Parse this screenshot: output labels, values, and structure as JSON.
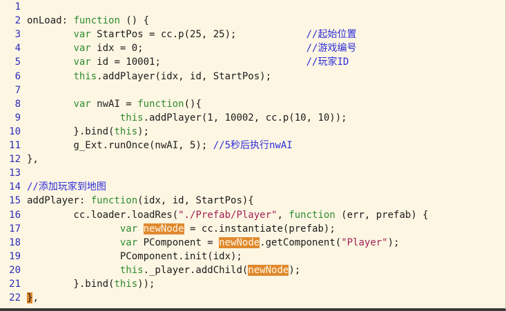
{
  "editor": {
    "lines": [
      {
        "n": "1",
        "segs": []
      },
      {
        "n": "2",
        "segs": [
          [
            "t",
            "onLoad: "
          ],
          [
            "k",
            "function"
          ],
          [
            "t",
            " () {"
          ]
        ]
      },
      {
        "n": "3",
        "segs": [
          [
            "t",
            "        "
          ],
          [
            "k",
            "var"
          ],
          [
            "t",
            " StartPos = cc.p(25, 25);            "
          ],
          [
            "c",
            "//起始位置"
          ]
        ]
      },
      {
        "n": "4",
        "segs": [
          [
            "t",
            "        "
          ],
          [
            "k",
            "var"
          ],
          [
            "t",
            " idx = 0;                            "
          ],
          [
            "c",
            "//游戏编号"
          ]
        ]
      },
      {
        "n": "5",
        "segs": [
          [
            "t",
            "        "
          ],
          [
            "k",
            "var"
          ],
          [
            "t",
            " id = 10001;                         "
          ],
          [
            "c",
            "//玩家ID"
          ]
        ]
      },
      {
        "n": "6",
        "segs": [
          [
            "t",
            "        "
          ],
          [
            "k",
            "this"
          ],
          [
            "t",
            ".addPlayer(idx, id, StartPos);"
          ]
        ]
      },
      {
        "n": "7",
        "segs": []
      },
      {
        "n": "8",
        "segs": [
          [
            "t",
            "        "
          ],
          [
            "k",
            "var"
          ],
          [
            "t",
            " nwAI = "
          ],
          [
            "k",
            "function"
          ],
          [
            "t",
            "(){"
          ]
        ]
      },
      {
        "n": "9",
        "segs": [
          [
            "t",
            "                "
          ],
          [
            "k",
            "this"
          ],
          [
            "t",
            ".addPlayer(1, 10002, cc.p(10, 10));"
          ]
        ]
      },
      {
        "n": "10",
        "segs": [
          [
            "t",
            "        }.bind("
          ],
          [
            "k",
            "this"
          ],
          [
            "t",
            ");"
          ]
        ]
      },
      {
        "n": "11",
        "segs": [
          [
            "t",
            "        g_Ext.runOnce(nwAI, 5); "
          ],
          [
            "c",
            "//5秒后执行nwAI"
          ]
        ]
      },
      {
        "n": "12",
        "segs": [
          [
            "t",
            "},"
          ]
        ]
      },
      {
        "n": "13",
        "segs": []
      },
      {
        "n": "14",
        "segs": [
          [
            "c",
            "//添加玩家到地图"
          ]
        ]
      },
      {
        "n": "15",
        "segs": [
          [
            "t",
            "addPlayer: "
          ],
          [
            "k",
            "function"
          ],
          [
            "t",
            "(idx, id, StartPos){"
          ]
        ]
      },
      {
        "n": "16",
        "segs": [
          [
            "t",
            "        cc.loader.loadRes("
          ],
          [
            "s",
            "\"./Prefab/Player\""
          ],
          [
            "t",
            ", "
          ],
          [
            "k",
            "function"
          ],
          [
            "t",
            " (err, prefab) {"
          ]
        ]
      },
      {
        "n": "17",
        "segs": [
          [
            "t",
            "                "
          ],
          [
            "k",
            "var"
          ],
          [
            "t",
            " "
          ],
          [
            "h",
            "newNode"
          ],
          [
            "t",
            " = cc.instantiate(prefab);"
          ]
        ]
      },
      {
        "n": "18",
        "segs": [
          [
            "t",
            "                "
          ],
          [
            "k",
            "var"
          ],
          [
            "t",
            " PComponent = "
          ],
          [
            "h",
            "newNode"
          ],
          [
            "t",
            ".getComponent("
          ],
          [
            "s",
            "\"Player\""
          ],
          [
            "t",
            ");"
          ]
        ]
      },
      {
        "n": "19",
        "segs": [
          [
            "t",
            "                PComponent.init(idx);"
          ]
        ]
      },
      {
        "n": "20",
        "segs": [
          [
            "t",
            "                "
          ],
          [
            "k",
            "this"
          ],
          [
            "t",
            "._player.addChild("
          ],
          [
            "h",
            "newNode"
          ],
          [
            "t",
            ");"
          ]
        ]
      },
      {
        "n": "21",
        "segs": [
          [
            "t",
            "        }.bind("
          ],
          [
            "k",
            "this"
          ],
          [
            "t",
            "));"
          ]
        ]
      },
      {
        "n": "22",
        "segs": [
          [
            "b",
            "}"
          ],
          [
            "t",
            ","
          ]
        ]
      }
    ]
  }
}
